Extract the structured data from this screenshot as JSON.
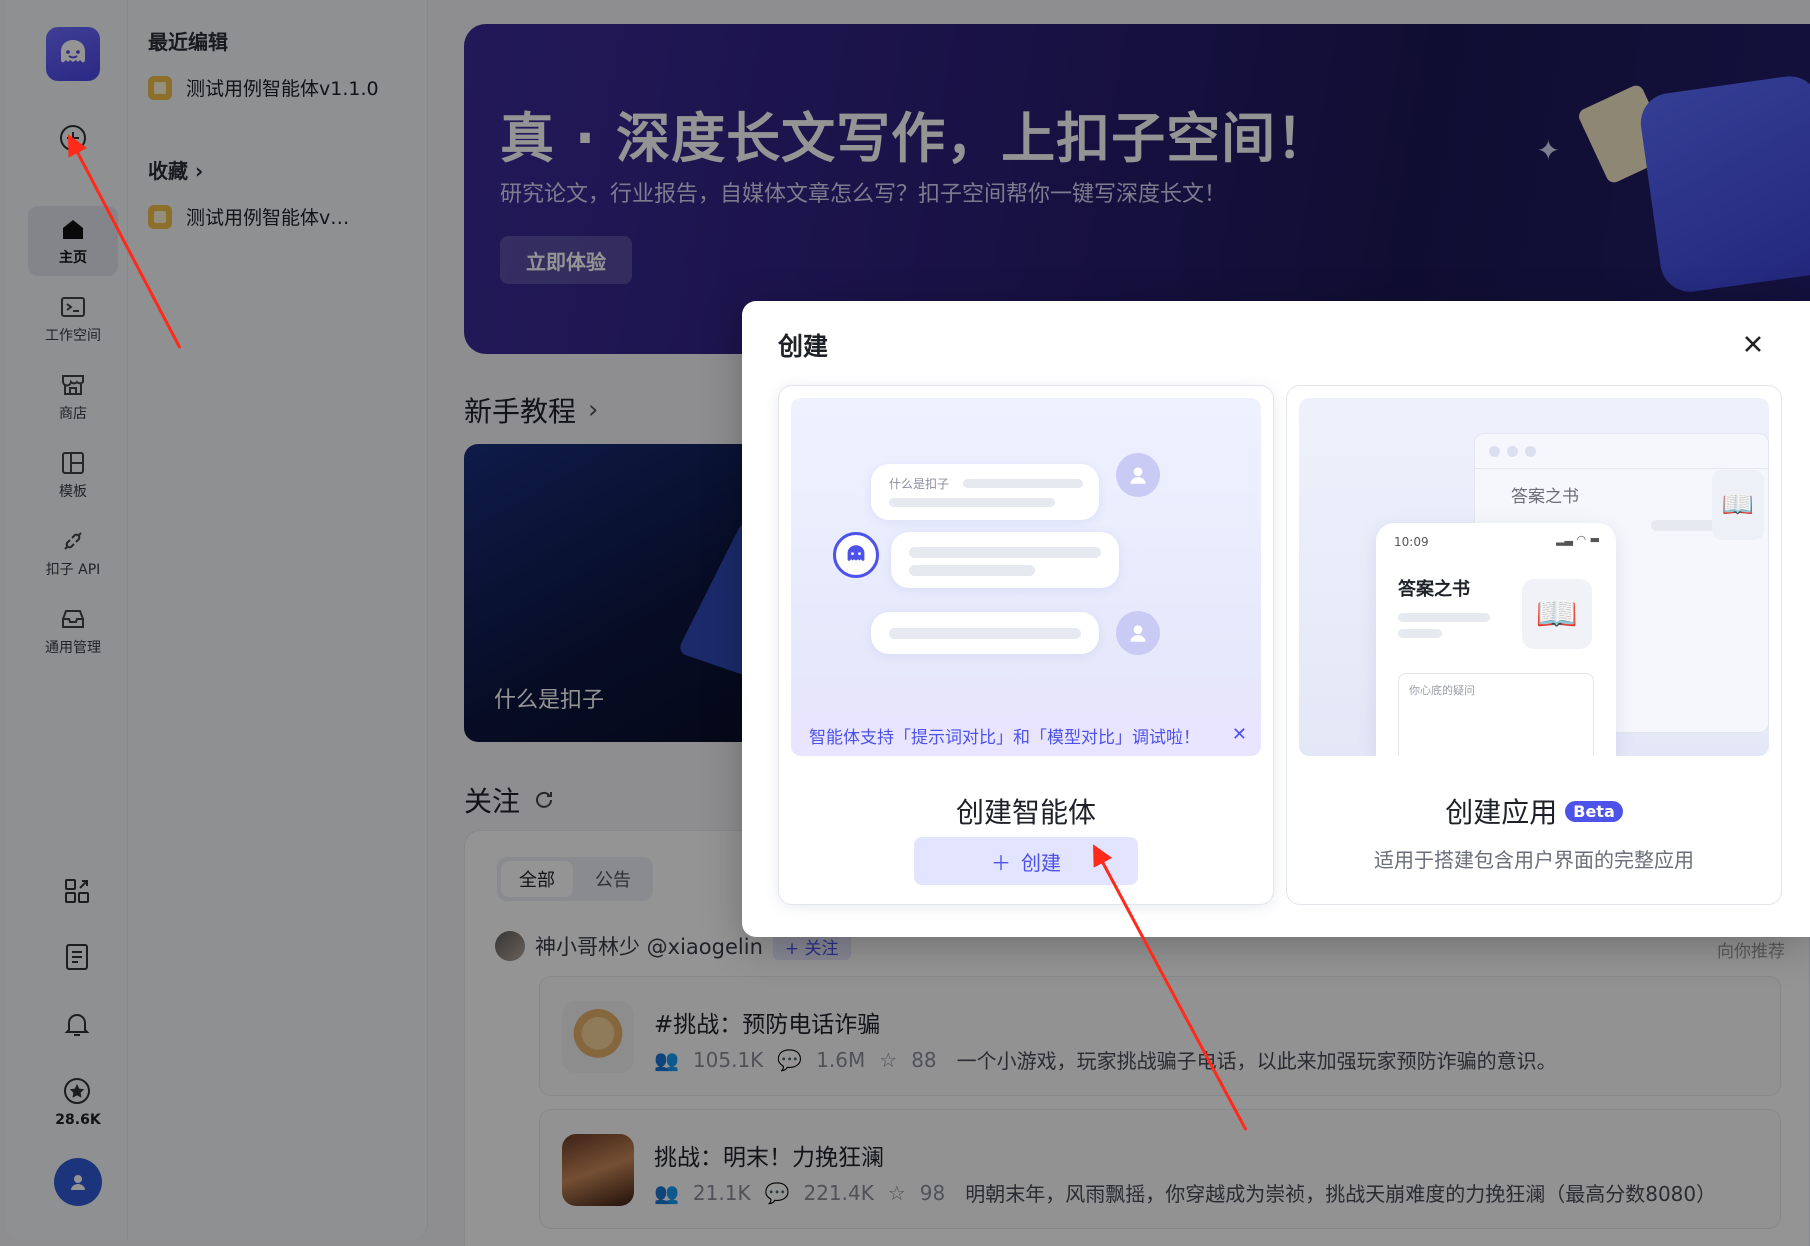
{
  "rail": {
    "items": [
      {
        "label": "主页",
        "icon": "home-icon",
        "active": true
      },
      {
        "label": "工作空间",
        "icon": "terminal-icon",
        "active": false
      },
      {
        "label": "商店",
        "icon": "store-icon",
        "active": false
      },
      {
        "label": "模板",
        "icon": "template-icon",
        "active": false
      },
      {
        "label": "扣子 API",
        "icon": "api-icon",
        "active": false
      },
      {
        "label": "通用管理",
        "icon": "inbox-icon",
        "active": false
      }
    ],
    "count": "28.6K"
  },
  "sidebar": {
    "recent_title": "最近编辑",
    "recent_item": "测试用例智能体v1.1.0",
    "favorites_title": "收藏 ›",
    "favorite_item": "测试用例智能体v…"
  },
  "banner": {
    "title": "真 · 深度长文写作，上扣子空间！",
    "subtitle": "研究论文，行业报告，自媒体文章怎么写？扣子空间帮你一键写深度长文！",
    "button": "立即体验"
  },
  "tutorial": {
    "title": "新手教程",
    "chevron": "›",
    "card_text": "什么是扣子"
  },
  "follow": {
    "title": "关注",
    "tabs": [
      "全部",
      "公告"
    ],
    "author": "神小哥林少 @xiaogelin",
    "follow_btn": "+ 关注",
    "recommend": "向你推荐",
    "bots": [
      {
        "name": "#挑战：预防电话诈骗",
        "users": "105.1K",
        "comments": "1.6M",
        "stars": "88",
        "desc": "一个小游戏，玩家挑战骗子电话，以此来加强玩家预防诈骗的意识。"
      },
      {
        "name": "挑战：明末！力挽狂澜",
        "users": "21.1K",
        "comments": "221.4K",
        "stars": "98",
        "desc": "明朝末年，风雨飘摇，你穿越成为崇祯，挑战天崩难度的力挽狂澜（最高分数8080）"
      }
    ]
  },
  "modal": {
    "title": "创建",
    "agent": {
      "preview_question": "什么是扣子",
      "notice": "智能体支持「提示词对比」和「模型对比」调试啦！",
      "title": "创建智能体",
      "button": "创建"
    },
    "app": {
      "window_title": "答案之书",
      "phone_time": "10:09",
      "phone_title": "答案之书",
      "placeholder": "你心底的疑问",
      "title": "创建应用",
      "badge": "Beta",
      "subtitle": "适用于搭建包含用户界面的完整应用"
    }
  },
  "colors": {
    "accent": "#4d53e8",
    "annotation": "#ff2a1a"
  }
}
